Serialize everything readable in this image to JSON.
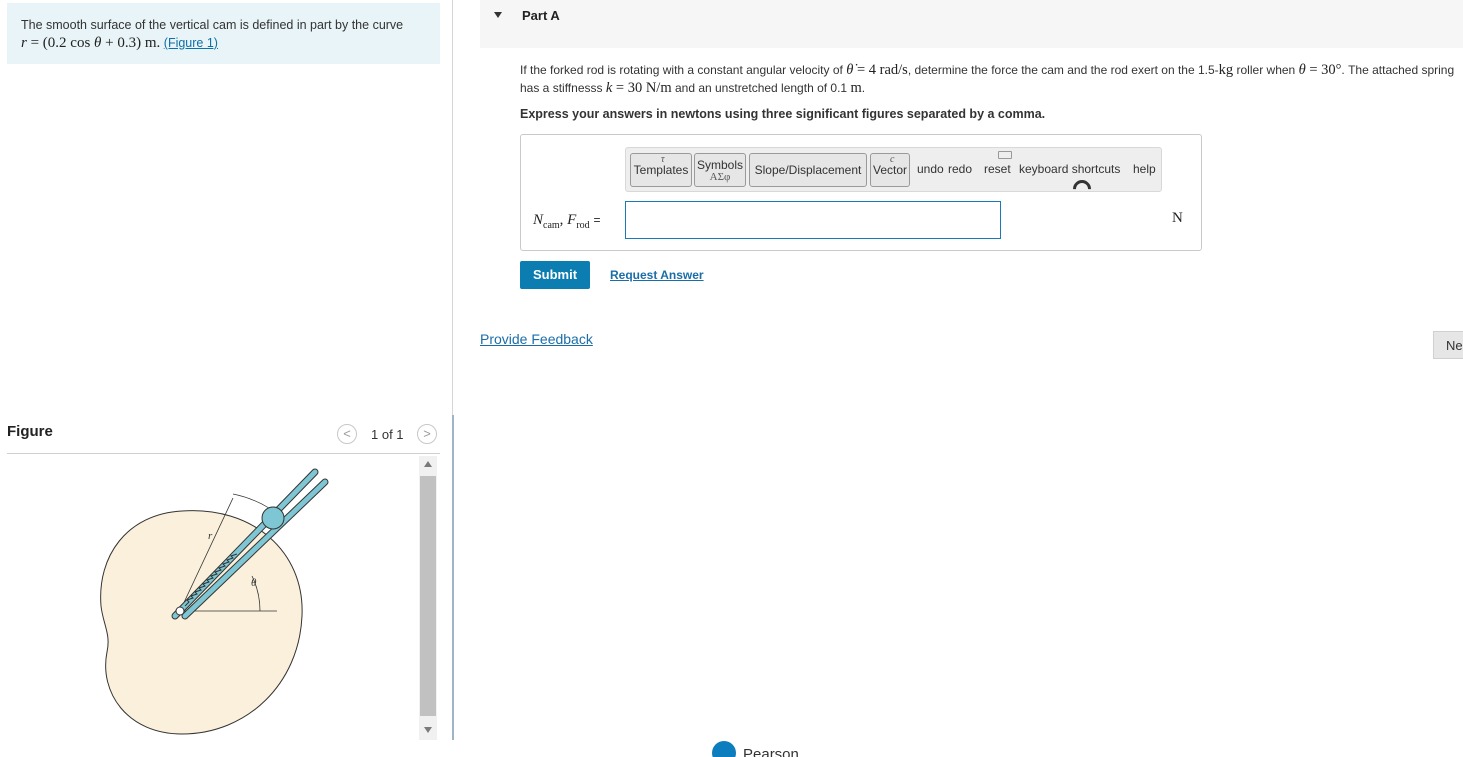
{
  "problem": {
    "intro_text": "The smooth surface of the vertical cam is defined in part by the curve",
    "curve_r": "r",
    "curve_eq": "= (0.2 cos",
    "curve_theta": "θ",
    "curve_tail": "+ 0.3) m.",
    "figure_link": "(Figure 1)"
  },
  "figure": {
    "title": "Figure",
    "pager_prev": "<",
    "pager_count": "1 of 1",
    "pager_next": ">",
    "label_r": "r",
    "label_theta": "θ"
  },
  "part": {
    "title": "Part A"
  },
  "question": {
    "text_1": "If the forked rod is rotating with a constant angular velocity of",
    "theta_dot": "θ̇",
    "omega_value": "= 4 rad/s",
    "text_2": ", determine the force the cam and the rod exert on the 1.5-",
    "kg": "kg",
    "text_3": "roller when",
    "theta": "θ",
    "angle_value": "= 30°",
    "text_4": ". The attached spring has a stiffnesss",
    "k": "k",
    "k_value": "= 30 N/m",
    "text_5": "and an unstretched length of 0.1",
    "m": "m",
    "text_end": "."
  },
  "instruction": "Express your answers in newtons using three significant figures separated by a comma.",
  "toolbar": {
    "templates": "Templates",
    "templates_deco": "τ",
    "symbols": "Symbols",
    "symbols_sub": "ΑΣφ",
    "slope": "Slope/Displacement",
    "vector": "Vector",
    "vector_deco": "c",
    "undo": "undo",
    "redo": "redo",
    "reset": "reset",
    "keyboard": "keyboard shortcuts",
    "help": "help"
  },
  "answer": {
    "label_n": "N",
    "label_n_sub": "cam",
    "label_sep": ",",
    "label_f": "F",
    "label_f_sub": "rod",
    "label_eq": "=",
    "input_value": "",
    "unit": "N"
  },
  "actions": {
    "submit": "Submit",
    "request_answer": "Request Answer",
    "provide_feedback": "Provide Feedback",
    "next": "Ne"
  },
  "footer": {
    "brand": "Pearson"
  },
  "colors": {
    "accent": "#0c7db1",
    "link": "#1a6ea8",
    "intro_bg": "#e8f4f7",
    "cam_fill": "#fbf0dc",
    "rod_fill": "#7ec6d3"
  }
}
